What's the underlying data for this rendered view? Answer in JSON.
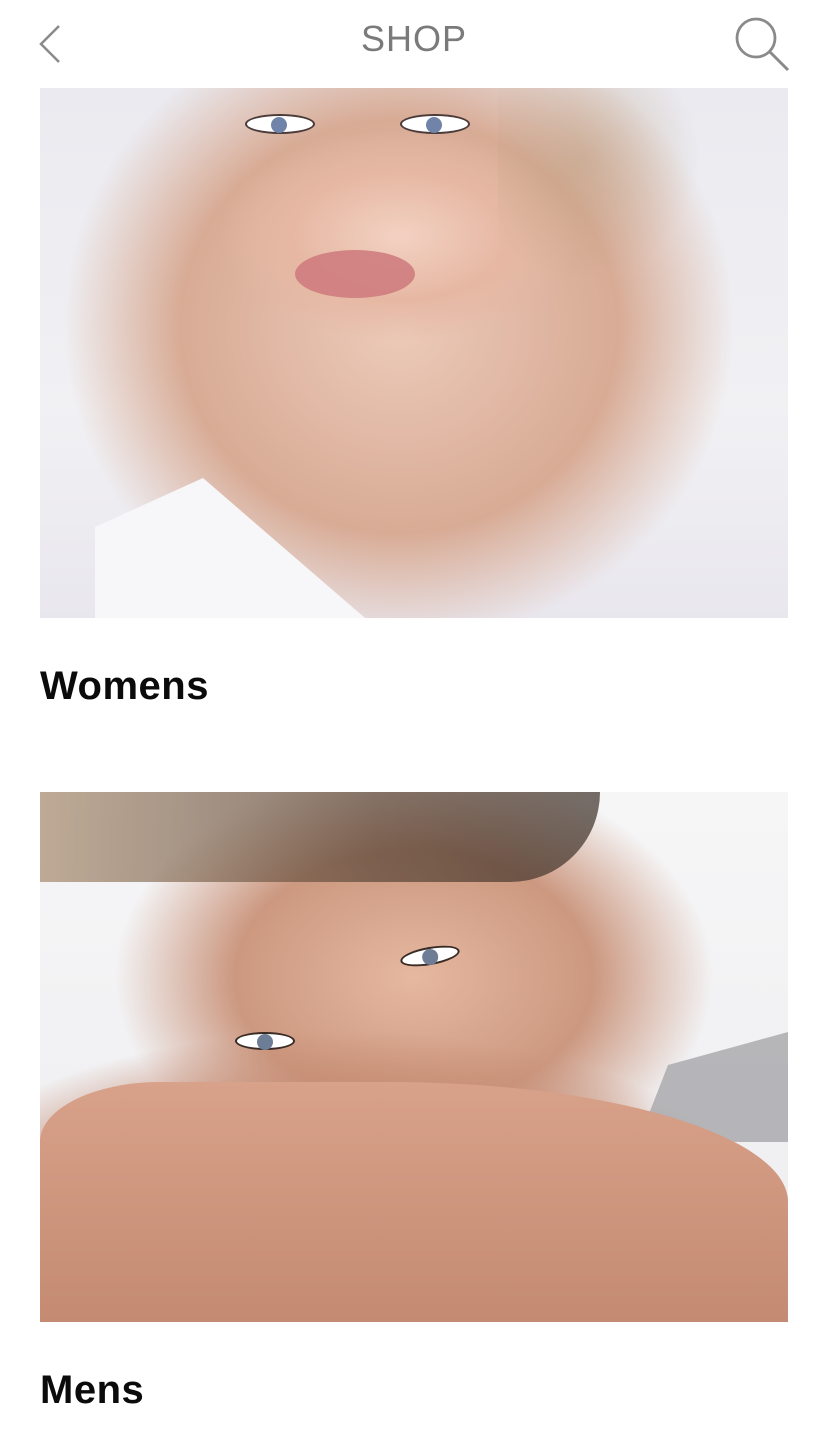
{
  "header": {
    "title": "SHOP",
    "back_icon": "chevron-left-icon",
    "search_icon": "search-icon"
  },
  "categories": [
    {
      "label": "Womens"
    },
    {
      "label": "Mens"
    }
  ],
  "colors": {
    "title_text": "#7a7a7a",
    "label_text": "#0b0b0b",
    "background": "#ffffff"
  }
}
